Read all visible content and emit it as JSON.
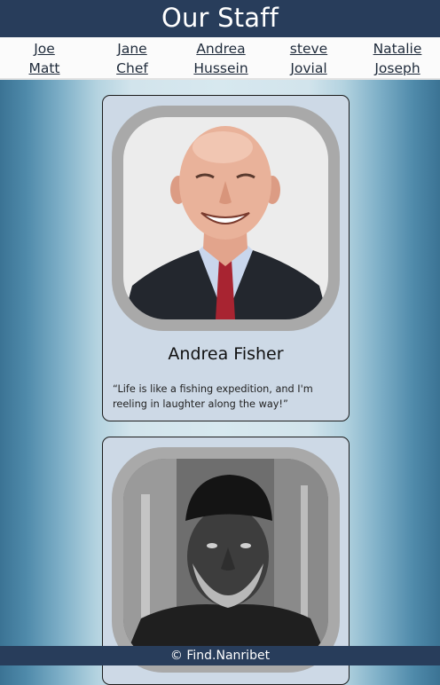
{
  "header": {
    "title": "Our Staff"
  },
  "nav": {
    "columns": [
      {
        "top": "Joe",
        "bottom": "Matt"
      },
      {
        "top": "Jane",
        "bottom": "Chef"
      },
      {
        "top": "Andrea",
        "bottom": "Hussein"
      },
      {
        "top": "steve",
        "bottom": "Jovial"
      },
      {
        "top": "Natalie",
        "bottom": "Joseph"
      }
    ]
  },
  "cards": [
    {
      "name": "Andrea Fisher",
      "quote": "“Life is like a fishing expedition, and I'm reeling in laughter along the way!”",
      "photo": "smiling-elderly-man-photo"
    },
    {
      "name": "",
      "quote": "",
      "photo": "bearded-man-in-cap-photo"
    }
  ],
  "footer": {
    "text": "© Find.Nanribet"
  },
  "colors": {
    "header_bg": "#283d5b",
    "card_bg": "#cdd9e6",
    "frame": "#a9a9a9"
  }
}
